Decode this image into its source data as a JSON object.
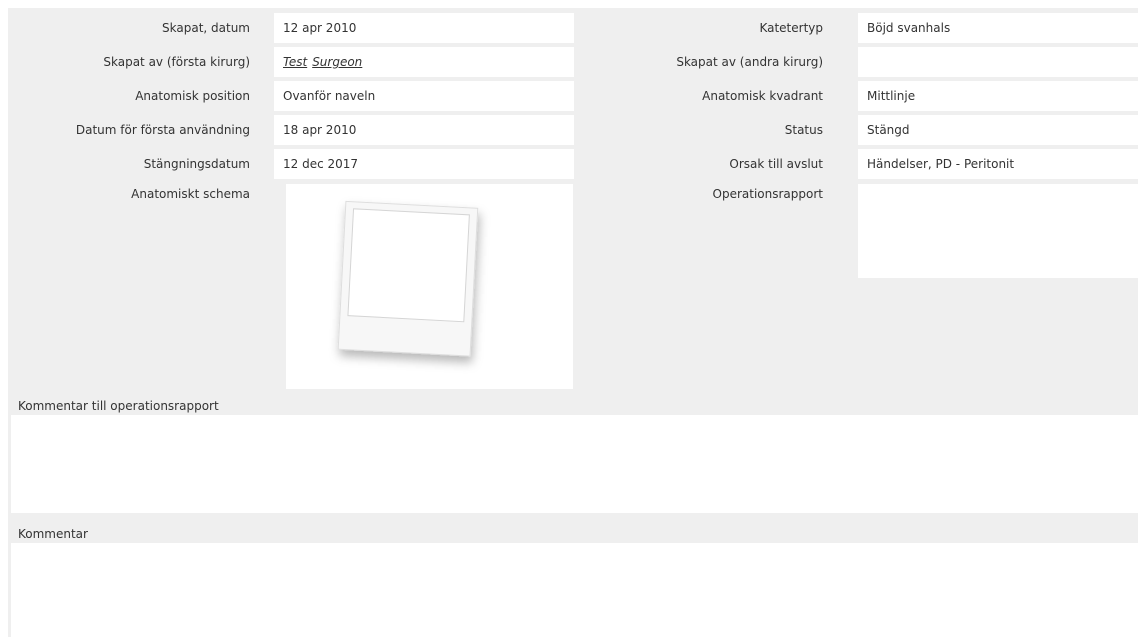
{
  "left_fields": [
    {
      "label": "Skapat, datum",
      "value": "12 apr 2010"
    },
    {
      "label": "Skapat av (första kirurg)",
      "links": [
        "Test",
        "Surgeon"
      ]
    },
    {
      "label": "Anatomisk position",
      "value": "Ovanför naveln"
    },
    {
      "label": "Datum för första användning",
      "value": "18 apr 2010"
    },
    {
      "label": "Stängningsdatum",
      "value": "12 dec 2017"
    },
    {
      "label": "Anatomiskt schema"
    }
  ],
  "right_fields": [
    {
      "label": "Katetertyp",
      "value": "Böjd svanhals"
    },
    {
      "label": "Skapat av (andra kirurg)",
      "value": ""
    },
    {
      "label": "Anatomisk kvadrant",
      "value": "Mittlinje"
    },
    {
      "label": "Status",
      "value": "Stängd"
    },
    {
      "label": "Orsak till avslut",
      "value": "Händelser, PD - Peritonit"
    },
    {
      "label": "Operationsrapport"
    }
  ],
  "sections": {
    "operation_comment_label": "Kommentar till operationsrapport",
    "comment_label": "Kommentar"
  },
  "colors": {
    "panel_bg": "#efefef",
    "field_bg": "#ffffff"
  },
  "icons": {
    "schema_placeholder": "photo-placeholder-icon"
  }
}
